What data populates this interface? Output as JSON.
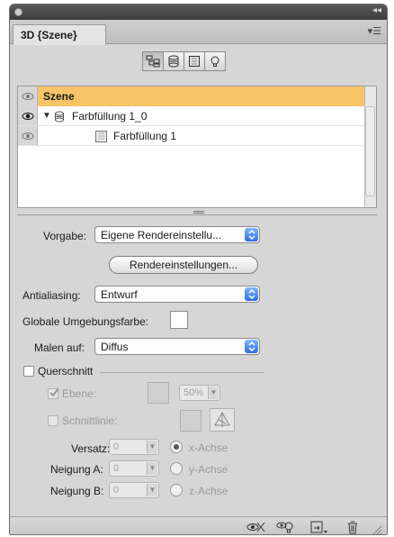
{
  "panel": {
    "tab_title": "3D {Szene}",
    "menu_icon": "panel-menu-icon",
    "collapse_icon": "double-chevron-icon"
  },
  "view_buttons": [
    {
      "name": "scene-view-icon",
      "selected": true
    },
    {
      "name": "mesh-view-icon",
      "selected": false
    },
    {
      "name": "materials-view-icon",
      "selected": false
    },
    {
      "name": "lights-view-icon",
      "selected": false
    }
  ],
  "scene_list": {
    "header": "Szene",
    "items": [
      {
        "label": "Farbfüllung 1_0"
      },
      {
        "label": "Farbfüllung 1"
      }
    ]
  },
  "settings": {
    "vorgabe_label": "Vorgabe:",
    "vorgabe_value": "Eigene Rendereinstellu...",
    "render_button": "Rendereinstellungen...",
    "antialiasing_label": "Antialiasing:",
    "antialiasing_value": "Entwurf",
    "globale_label": "Globale Umgebungsfarbe:",
    "malen_label": "Malen auf:",
    "malen_value": "Diffus"
  },
  "querschnitt": {
    "label": "Querschnitt",
    "ebene_label": "Ebene:",
    "ebene_percent": "50%",
    "schnittlinie_label": "Schnittlinie:",
    "versatz_label": "Versatz:",
    "neigung_a_label": "Neigung A:",
    "neigung_b_label": "Neigung B:",
    "versatz_value": "0",
    "neigung_a_value": "0",
    "neigung_b_value": "0",
    "x_axis": "x-Achse",
    "y_axis": "y-Achse",
    "z_axis": "z-Achse"
  },
  "colors": {
    "selected_row": "#f8c467",
    "panel_bg": "#d6d6d6",
    "select_arrow": "#2f6ee0"
  }
}
